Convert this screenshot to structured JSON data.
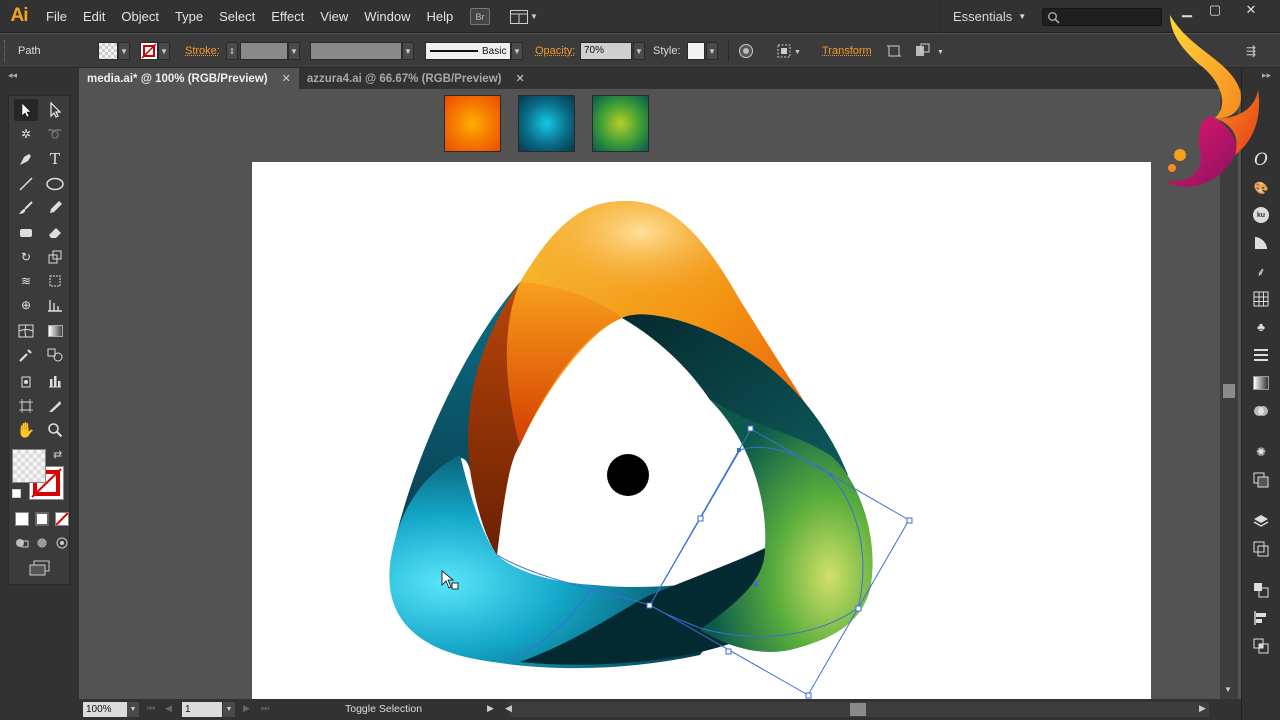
{
  "app": {
    "logo": "Ai"
  },
  "menu": [
    "File",
    "Edit",
    "Object",
    "Type",
    "Select",
    "Effect",
    "View",
    "Window",
    "Help"
  ],
  "bridge_label": "Br",
  "workspace": {
    "label": "Essentials"
  },
  "control_bar": {
    "selection_type": "Path",
    "stroke_label": "Stroke:",
    "brush_label": "Basic",
    "opacity_label": "Opacity:",
    "opacity_value": "70%",
    "style_label": "Style:",
    "transform_label": "Transform"
  },
  "tabs": [
    {
      "label": "media.ai* @ 100% (RGB/Preview)",
      "active": true
    },
    {
      "label": "azzura4.ai @ 66.67% (RGB/Preview)",
      "active": false
    }
  ],
  "status": {
    "zoom": "100%",
    "page": "1",
    "text": "Toggle Selection"
  },
  "swatches": [
    {
      "name": "orange radial",
      "inner": "#ffb000",
      "outer": "#ee4a00"
    },
    {
      "name": "cyan radial",
      "inner": "#14c8e6",
      "outer": "#033a4a"
    },
    {
      "name": "green radial",
      "inner": "#b4d028",
      "outer": "#085a50"
    }
  ],
  "colors": {
    "accent_orange": "#f29a2e",
    "ui_dark": "#323232",
    "ui_panel": "#3b3b3b",
    "canvas": "#535353",
    "selection_blue": "#3a6fd8"
  },
  "icons": [
    "selection-icon",
    "direct-selection-icon",
    "magic-wand-icon",
    "lasso-icon",
    "pen-icon",
    "type-icon",
    "line-icon",
    "ellipse-icon",
    "paintbrush-icon",
    "pencil-icon",
    "blob-brush-icon",
    "eraser-icon",
    "rotate-icon",
    "scale-icon",
    "width-icon",
    "free-transform-icon",
    "shape-builder-icon",
    "perspective-icon",
    "mesh-icon",
    "gradient-icon",
    "eyedropper-icon",
    "blend-icon",
    "symbol-sprayer-icon",
    "graph-icon",
    "artboard-icon",
    "slice-icon",
    "hand-icon",
    "zoom-icon"
  ]
}
